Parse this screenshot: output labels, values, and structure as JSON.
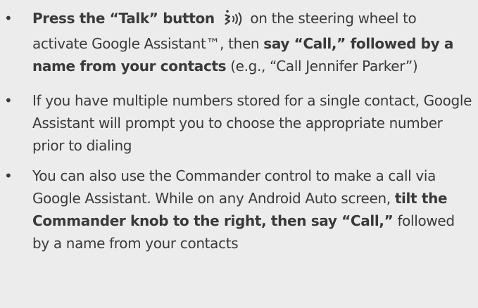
{
  "bullet_symbol": "•",
  "bullets": [
    {
      "segments": [
        {
          "text": "Press the “Talk” button ",
          "bold": true
        },
        {
          "icon": "voice-talk-icon"
        },
        {
          "text": " on the steering wheel to activate Google Assistant™, then ",
          "bold": false
        },
        {
          "text": "say “Call,” followed by a name from your contacts",
          "bold": true
        },
        {
          "text": " (e.g., “Call Jennifer Parker”)",
          "bold": false
        }
      ]
    },
    {
      "segments": [
        {
          "text": "If you have multiple numbers stored for a single contact, Google Assistant will prompt you to choose the appropriate number prior to dialing",
          "bold": false
        }
      ]
    },
    {
      "segments": [
        {
          "text": "You can also use the Commander control to make a call via Google Assistant. While on any Android Auto screen, ",
          "bold": false
        },
        {
          "text": "tilt the Commander knob to the right, then say “Call,”",
          "bold": true
        },
        {
          "text": " followed by a name from your contacts",
          "bold": false
        }
      ]
    }
  ],
  "colors": {
    "background": "#ececec",
    "text": "#3a3a3a"
  }
}
